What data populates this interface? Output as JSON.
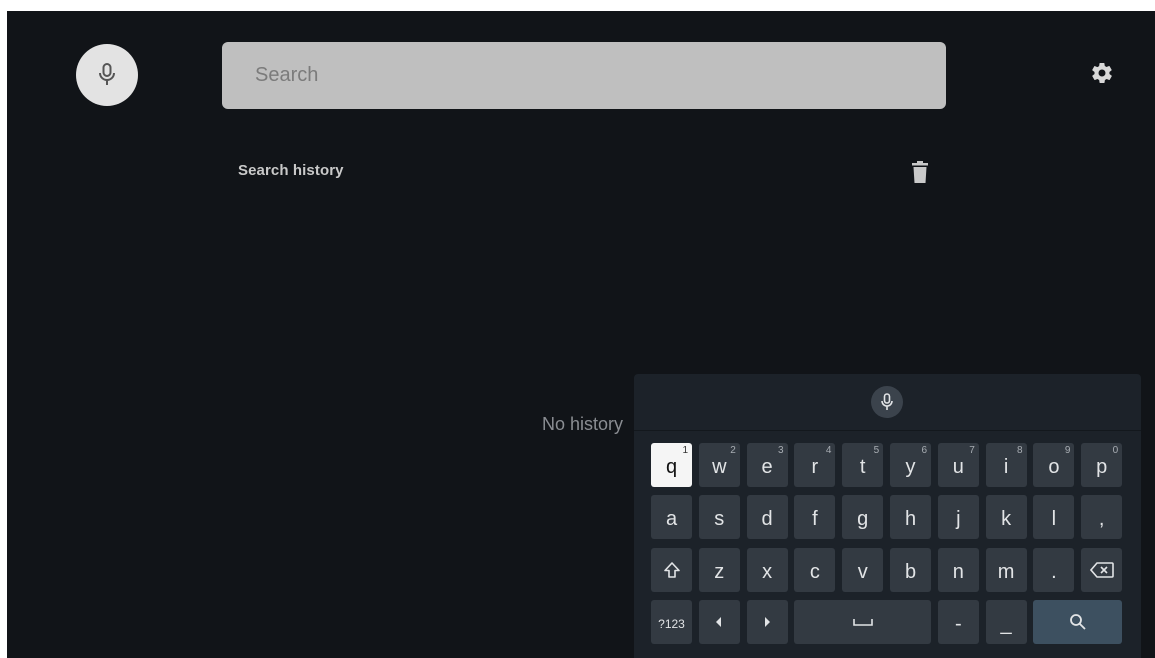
{
  "search": {
    "placeholder": "Search"
  },
  "history": {
    "title": "Search history",
    "empty_message": "No history"
  },
  "keyboard": {
    "rows": [
      [
        {
          "label": "q",
          "hint": "1",
          "focused": true
        },
        {
          "label": "w",
          "hint": "2"
        },
        {
          "label": "e",
          "hint": "3"
        },
        {
          "label": "r",
          "hint": "4"
        },
        {
          "label": "t",
          "hint": "5"
        },
        {
          "label": "y",
          "hint": "6"
        },
        {
          "label": "u",
          "hint": "7"
        },
        {
          "label": "i",
          "hint": "8"
        },
        {
          "label": "o",
          "hint": "9"
        },
        {
          "label": "p",
          "hint": "0"
        }
      ],
      [
        {
          "label": "a"
        },
        {
          "label": "s"
        },
        {
          "label": "d"
        },
        {
          "label": "f"
        },
        {
          "label": "g"
        },
        {
          "label": "h"
        },
        {
          "label": "j"
        },
        {
          "label": "k"
        },
        {
          "label": "l"
        },
        {
          "label": ","
        }
      ],
      [
        {
          "icon": "shift-icon"
        },
        {
          "label": "z"
        },
        {
          "label": "x"
        },
        {
          "label": "c"
        },
        {
          "label": "v"
        },
        {
          "label": "b"
        },
        {
          "label": "n"
        },
        {
          "label": "m"
        },
        {
          "label": "."
        },
        {
          "icon": "backspace-icon"
        }
      ],
      [
        {
          "label": "?123",
          "small": true
        },
        {
          "icon": "arrow-left-icon"
        },
        {
          "icon": "arrow-right-icon"
        },
        {
          "icon": "space-icon",
          "span": 3
        },
        {
          "label": "-"
        },
        {
          "label": "_"
        },
        {
          "icon": "search-icon",
          "span": 2,
          "accent": true
        }
      ]
    ]
  },
  "colors": {
    "background": "#111418",
    "keyboard_bg": "#1c2229",
    "key_bg": "#333a42",
    "key_focused_bg": "#f5f5f5",
    "search_key_bg": "#3d5060"
  }
}
